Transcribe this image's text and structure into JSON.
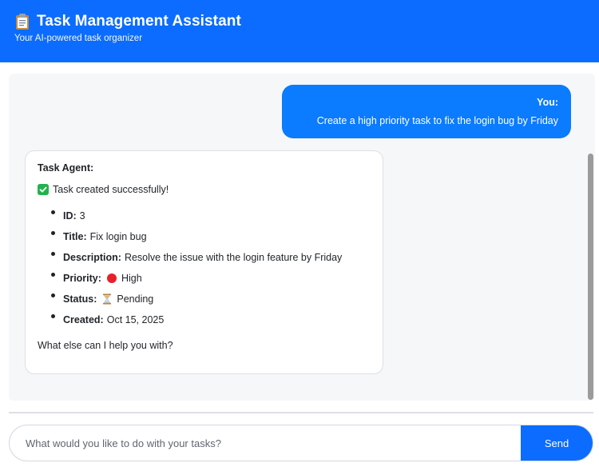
{
  "header": {
    "title": "Task Management Assistant",
    "subtitle": "Your AI-powered task organizer",
    "icon": "clipboard-icon"
  },
  "messages": {
    "user": {
      "sender": "You:",
      "text": "Create a high priority task to fix the login bug by Friday"
    },
    "agent": {
      "sender": "Task Agent:",
      "status_text": "Task created successfully!",
      "status_icon": "check-icon",
      "details": [
        {
          "label": "ID:",
          "value": "3"
        },
        {
          "label": "Title:",
          "value": "Fix login bug"
        },
        {
          "label": "Description:",
          "value": "Resolve the issue with the login feature by Friday"
        },
        {
          "label": "Priority:",
          "value": "High",
          "icon": "red-dot-icon"
        },
        {
          "label": "Status:",
          "value": "Pending",
          "icon": "hourglass-icon"
        },
        {
          "label": "Created:",
          "value": "Oct 15, 2025"
        }
      ],
      "closing": "What else can I help you with?"
    }
  },
  "composer": {
    "placeholder": "What would you like to do with your tasks?",
    "value": "",
    "send_label": "Send"
  },
  "colors": {
    "primary": "#0b6cff",
    "user_bubble": "#0b7bff",
    "chat_bg": "#f6f7f9",
    "success": "#22b24c",
    "priority_high": "#e8202a"
  }
}
